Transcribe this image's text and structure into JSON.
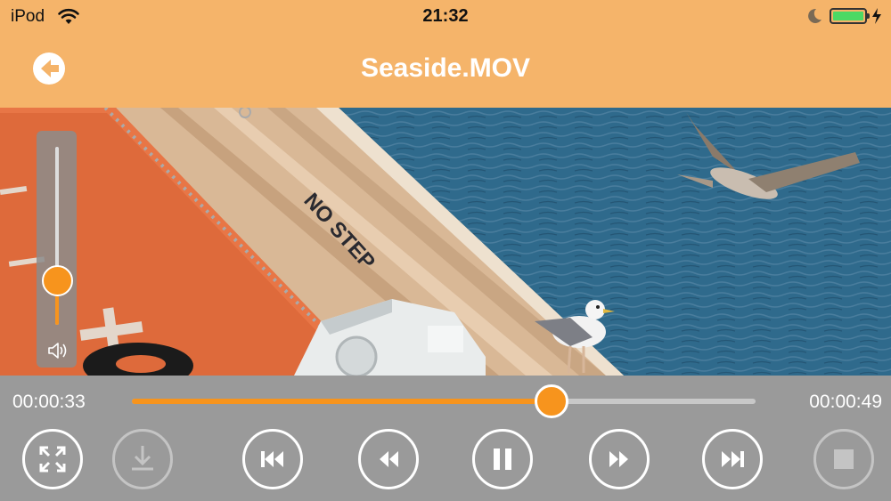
{
  "status_bar": {
    "carrier": "iPod",
    "time": "21:32",
    "battery_level": 1.0,
    "icons": [
      "wifi-icon",
      "moon-icon",
      "battery-icon",
      "charging-bolt-icon"
    ]
  },
  "header": {
    "title": "Seaside.MOV",
    "back_icon": "back-arrow-icon"
  },
  "video": {
    "painted_text": "NO STEP"
  },
  "volume": {
    "level": 0.25,
    "icon": "speaker-icon"
  },
  "playback": {
    "current_time": "00:00:33",
    "total_time": "00:00:49",
    "progress": 0.673
  },
  "controls": [
    {
      "name": "fullscreen",
      "icon": "fullscreen-icon",
      "enabled": true
    },
    {
      "name": "download",
      "icon": "download-icon",
      "enabled": false
    },
    {
      "name": "skip-back",
      "icon": "skip-back-icon",
      "enabled": true
    },
    {
      "name": "rewind",
      "icon": "rewind-icon",
      "enabled": true
    },
    {
      "name": "pause",
      "icon": "pause-icon",
      "enabled": true
    },
    {
      "name": "fast-forward",
      "icon": "fast-forward-icon",
      "enabled": true
    },
    {
      "name": "skip-forward",
      "icon": "skip-forward-icon",
      "enabled": true
    },
    {
      "name": "stop",
      "icon": "stop-icon",
      "enabled": false
    }
  ],
  "colors": {
    "header_bg": "#f5b46a",
    "accent": "#f7941d",
    "controls_bg": "#9a9a9a"
  }
}
